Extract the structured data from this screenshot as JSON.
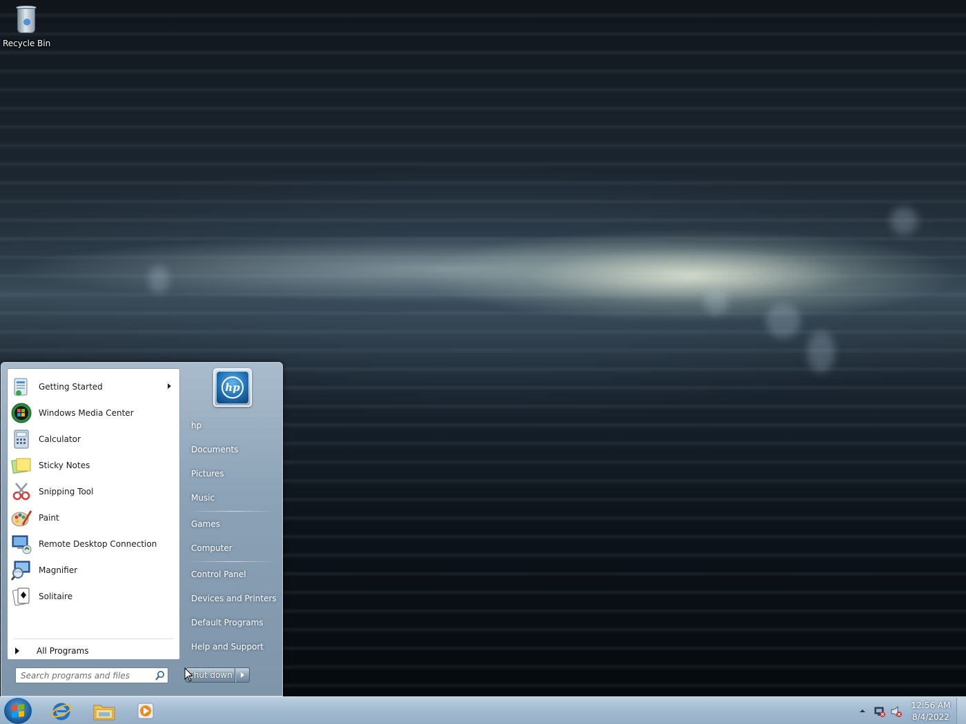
{
  "desktop": {
    "icons": [
      {
        "label": "Recycle Bin",
        "icon": "recycle-bin-icon"
      }
    ]
  },
  "start_menu": {
    "programs": [
      {
        "label": "Getting Started",
        "icon": "getting-started-icon",
        "has_submenu": true
      },
      {
        "label": "Windows Media Center",
        "icon": "windows-media-center-icon"
      },
      {
        "label": "Calculator",
        "icon": "calculator-icon"
      },
      {
        "label": "Sticky Notes",
        "icon": "sticky-notes-icon"
      },
      {
        "label": "Snipping Tool",
        "icon": "snipping-tool-icon"
      },
      {
        "label": "Paint",
        "icon": "paint-icon"
      },
      {
        "label": "Remote Desktop Connection",
        "icon": "remote-desktop-icon"
      },
      {
        "label": "Magnifier",
        "icon": "magnifier-icon"
      },
      {
        "label": "Solitaire",
        "icon": "solitaire-icon"
      }
    ],
    "all_programs_label": "All Programs",
    "search_placeholder": "Search programs and files",
    "user_picture": "hp-logo",
    "user_picture_text": "hp",
    "places": [
      {
        "label": "hp"
      },
      {
        "label": "Documents"
      },
      {
        "label": "Pictures"
      },
      {
        "label": "Music"
      },
      {
        "label": "Games"
      },
      {
        "label": "Computer"
      },
      {
        "label": "Control Panel"
      },
      {
        "label": "Devices and Printers"
      },
      {
        "label": "Default Programs"
      },
      {
        "label": "Help and Support"
      }
    ],
    "shutdown_label": "Shut down"
  },
  "taskbar": {
    "pinned": [
      {
        "name": "Internet Explorer",
        "icon": "internet-explorer-icon"
      },
      {
        "name": "Windows Explorer",
        "icon": "folder-icon"
      },
      {
        "name": "Windows Media Player",
        "icon": "media-player-icon"
      }
    ],
    "tray_icons": [
      "network-icon",
      "volume-muted-icon"
    ],
    "clock": {
      "time": "12:56 AM",
      "date": "8/4/2022"
    }
  },
  "colors": {
    "taskbar": "#a4bcd2",
    "start_menu_frame": "#8ca2b6",
    "accent_blue": "#1f6fb3"
  }
}
